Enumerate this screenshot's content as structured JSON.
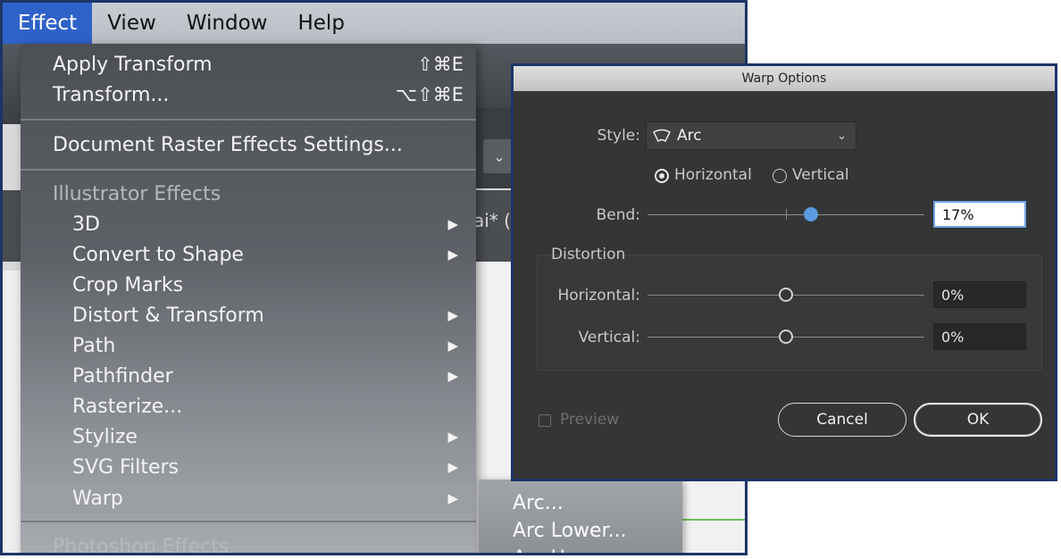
{
  "menubar": {
    "items": [
      "Effect",
      "View",
      "Window",
      "Help"
    ],
    "active": "Effect"
  },
  "background": {
    "tab_fragment": "ai* ("
  },
  "effect_menu": {
    "apply_transform": {
      "label": "Apply Transform",
      "shortcut": "⇧⌘E"
    },
    "transform": {
      "label": "Transform...",
      "shortcut": "⌥⇧⌘E"
    },
    "document_raster": {
      "label": "Document Raster Effects Settings..."
    },
    "illustrator_header": "Illustrator Effects",
    "items": [
      {
        "label": "3D",
        "submenu": true
      },
      {
        "label": "Convert to Shape",
        "submenu": true
      },
      {
        "label": "Crop Marks",
        "submenu": false
      },
      {
        "label": "Distort & Transform",
        "submenu": true
      },
      {
        "label": "Path",
        "submenu": true
      },
      {
        "label": "Pathfinder",
        "submenu": true
      },
      {
        "label": "Rasterize...",
        "submenu": false
      },
      {
        "label": "Stylize",
        "submenu": true
      },
      {
        "label": "SVG Filters",
        "submenu": true
      },
      {
        "label": "Warp",
        "submenu": true,
        "highlighted": true
      }
    ],
    "photoshop_header": "Photoshop Effects",
    "arrow_glyph": "▶"
  },
  "warp_submenu": {
    "items": [
      "Arc...",
      "Arc Lower...",
      "Arc Upper..."
    ]
  },
  "dialog": {
    "title": "Warp Options",
    "style_label": "Style:",
    "style_value": "Arc",
    "orientation": {
      "horizontal": "Horizontal",
      "vertical": "Vertical",
      "selected": "Horizontal"
    },
    "bend_label": "Bend:",
    "bend_value": "17%",
    "bend_fraction": 0.59,
    "distortion_title": "Distortion",
    "dist_horizontal_label": "Horizontal:",
    "dist_horizontal_value": "0%",
    "dist_vertical_label": "Vertical:",
    "dist_vertical_value": "0%",
    "preview_label": "Preview",
    "cancel_label": "Cancel",
    "ok_label": "OK",
    "accent_color": "#5b9bdf"
  }
}
